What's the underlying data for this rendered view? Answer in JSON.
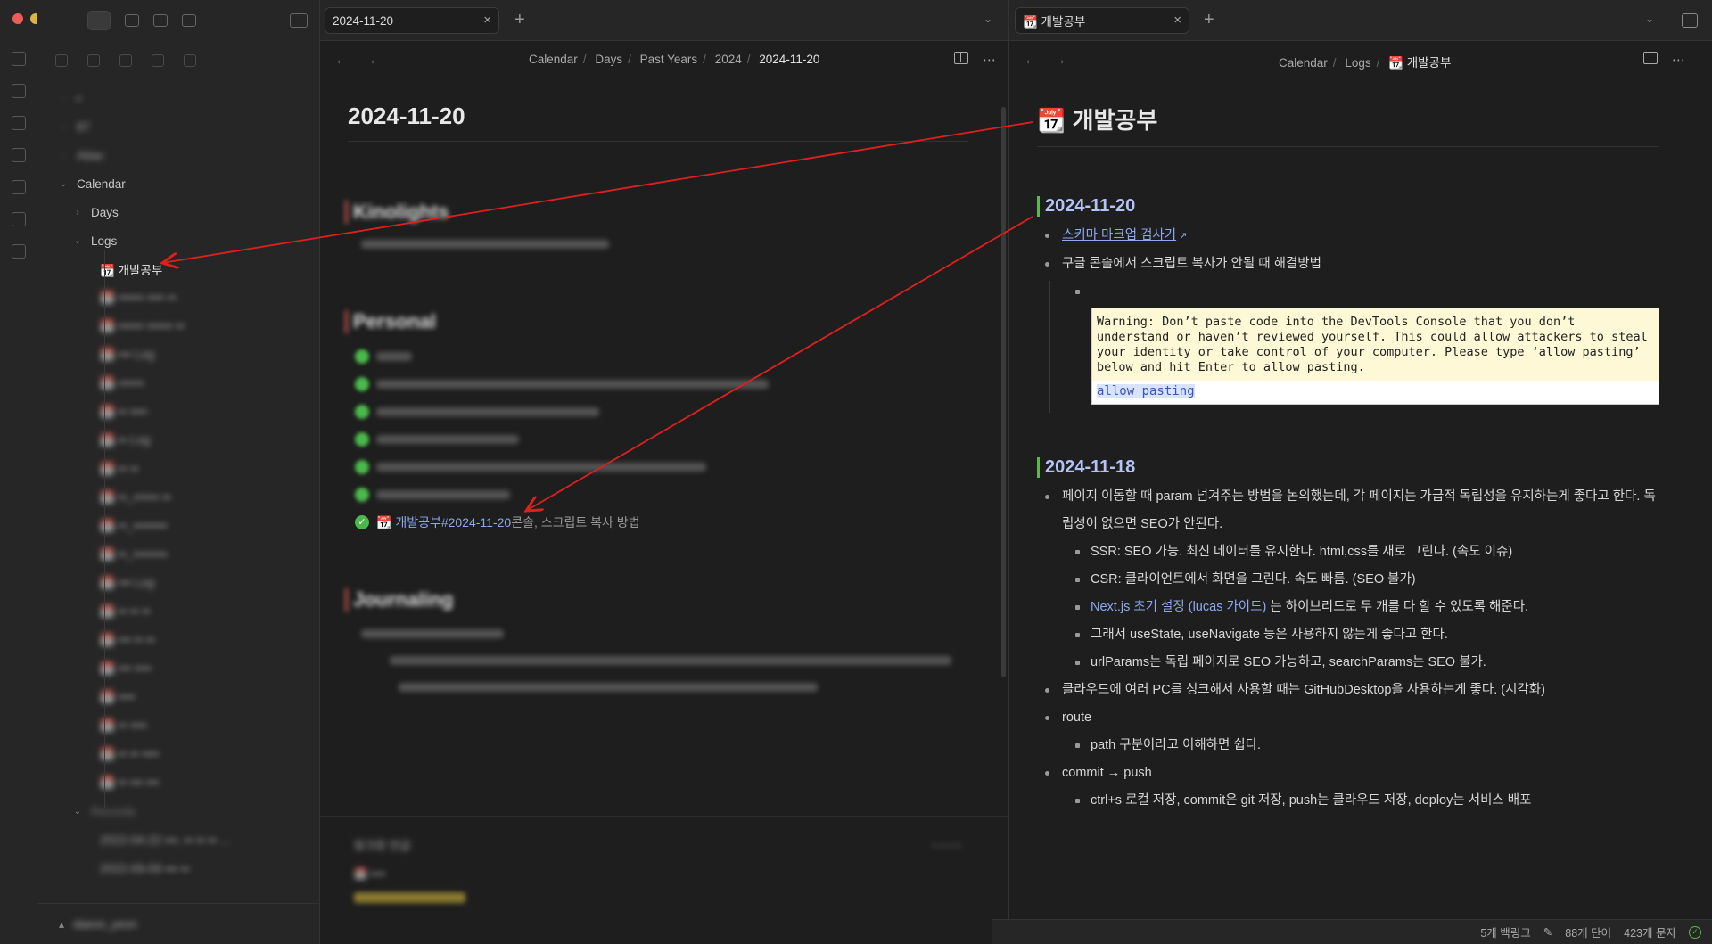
{
  "left_tab": {
    "title": "2024-11-20",
    "close": "×",
    "add": "+"
  },
  "right_tab": {
    "title": "📆 개발공부",
    "close": "×",
    "add": "+"
  },
  "left_pane": {
    "breadcrumb": [
      "Calendar",
      "Days",
      "Past Years",
      "2024",
      "2024-11-20"
    ],
    "title": "2024-11-20",
    "sections": [
      "Kinolights",
      "Personal",
      "Journaling"
    ],
    "linked_task": {
      "link": "📆 개발공부#2024-11-20",
      "rest": " 콘솔, 스크립트 복사 방법"
    },
    "backlinks_header": "링크된 언급"
  },
  "right_pane": {
    "breadcrumb": [
      "Calendar",
      "Logs",
      "📆 개발공부"
    ],
    "title": "📆 개발공부",
    "sections": [
      {
        "heading": "2024-11-20",
        "items": [
          {
            "text": "스키마 마크업 검사기",
            "link": true,
            "level": 1
          },
          {
            "text": "구글 콘솔에서 스크립트 복사가 안될 때 해결방법",
            "level": 1
          }
        ],
        "code": {
          "warning": "Warning: Don’t paste code into the DevTools Console that you don’t understand or haven’t reviewed yourself. This could allow attackers to steal your identity or take control of your computer. Please type ‘allow pasting’ below and hit Enter to allow pasting.",
          "typed": "allow pasting"
        }
      },
      {
        "heading": "2024-11-18",
        "items": [
          {
            "text": "페이지 이동할 때 param 넘겨주는 방법을 논의했는데, 각 페이지는 가급적 독립성을 유지하는게 좋다고 한다. 독립성이 없으면 SEO가 안된다.",
            "level": 1
          },
          {
            "text": "SSR: SEO 가능. 최신 데이터를 유지한다. html,css를 새로 그린다. (속도 이슈)",
            "level": 2
          },
          {
            "text": "CSR: 클라이언트에서 화면을 그린다. 속도 빠름. (SEO 불가)",
            "level": 2
          },
          {
            "link_text": "Next.js 초기 설정 (lucas 가이드)",
            "text": " 는 하이브리드로 두 개를 다 할 수 있도록 해준다.",
            "level": 2
          },
          {
            "text": "그래서 useState, useNavigate 등은 사용하지 않는게 좋다고 한다.",
            "level": 2
          },
          {
            "text": "urlParams는 독립 페이지로 SEO 가능하고, searchParams는 SEO 불가.",
            "level": 2
          },
          {
            "text": "클라우드에 여러 PC를 싱크해서 사용할 때는 GitHubDesktop을 사용하는게 좋다. (시각화)",
            "level": 1
          },
          {
            "text": "route",
            "level": 1
          },
          {
            "text": "path 구분이라고 이해하면 쉽다.",
            "level": 2
          },
          {
            "text": "commit → push",
            "level": 1
          },
          {
            "text": "ctrl+s 로컬 저장, commit은 git 저장, push는 클라우드 저장, deploy는 서비스 배포",
            "level": 2
          }
        ]
      }
    ]
  },
  "sidebar": {
    "tree": {
      "calendar": "Calendar",
      "days": "Days",
      "logs": "Logs",
      "active_file": "📆 개발공부",
      "records": "Records"
    },
    "vault": "daeon_yeon"
  },
  "status": {
    "backlinks": "5개 백링크",
    "words": "88개 단어",
    "chars": "423개 문자"
  },
  "colors": {
    "accent": "#8fa8f0",
    "heading_bar": "#5fb650",
    "arrow": "#e0201e"
  }
}
